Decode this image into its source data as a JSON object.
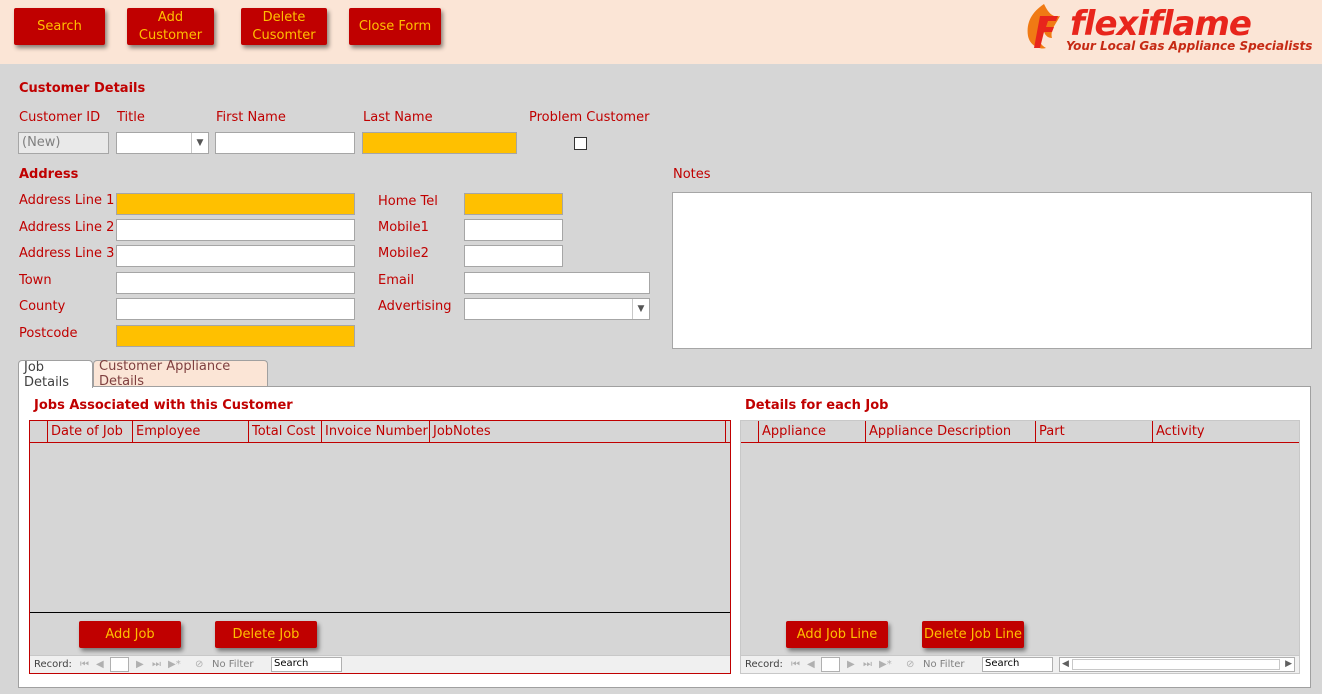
{
  "toolbar": {
    "search_label": "Search",
    "add_customer_label": "Add\nCustomer",
    "delete_customer_label": "Delete\nCusomter",
    "close_form_label": "Close Form"
  },
  "logo": {
    "word": "flexiflame",
    "tagline": "Your Local Gas Appliance Specialists"
  },
  "customer": {
    "section_title": "Customer Details",
    "customer_id_label": "Customer ID",
    "customer_id_value": "(New)",
    "title_label": "Title",
    "first_name_label": "First Name",
    "last_name_label": "Last Name",
    "problem_customer_label": "Problem Customer"
  },
  "address": {
    "section_title": "Address",
    "line1_label": "Address Line 1",
    "line2_label": "Address Line 2",
    "line3_label": "Address Line 3",
    "town_label": "Town",
    "county_label": "County",
    "postcode_label": "Postcode"
  },
  "contact": {
    "home_tel_label": "Home Tel",
    "mobile1_label": "Mobile1",
    "mobile2_label": "Mobile2",
    "email_label": "Email",
    "advertising_label": "Advertising"
  },
  "notes": {
    "label": "Notes"
  },
  "tabs": [
    {
      "label": "Job Details"
    },
    {
      "label": "Customer Appliance Details"
    }
  ],
  "jobs": {
    "title": "Jobs Associated with this Customer",
    "columns": [
      "Date of Job",
      "Employee",
      "Total Cost",
      "Invoice Number",
      "JobNotes"
    ],
    "add_label": "Add Job",
    "delete_label": "Delete Job"
  },
  "job_lines": {
    "title": "Details for each Job",
    "columns": [
      "Appliance",
      "Appliance Description",
      "Part",
      "Activity"
    ],
    "add_label": "Add Job Line",
    "delete_label": "Delete Job Line"
  },
  "navbar": {
    "record_label": "Record:",
    "first": "⏮",
    "prev": "◀",
    "next": "▶",
    "last": "⏭",
    "new": "▶*",
    "filter_label": "No Filter",
    "search_label": "Search"
  },
  "colors": {
    "accent": "#c00000",
    "button_text": "#ffc000",
    "required_field": "#ffc000",
    "header_bg": "#fbe5d6",
    "form_bg": "#d6d6d6"
  }
}
